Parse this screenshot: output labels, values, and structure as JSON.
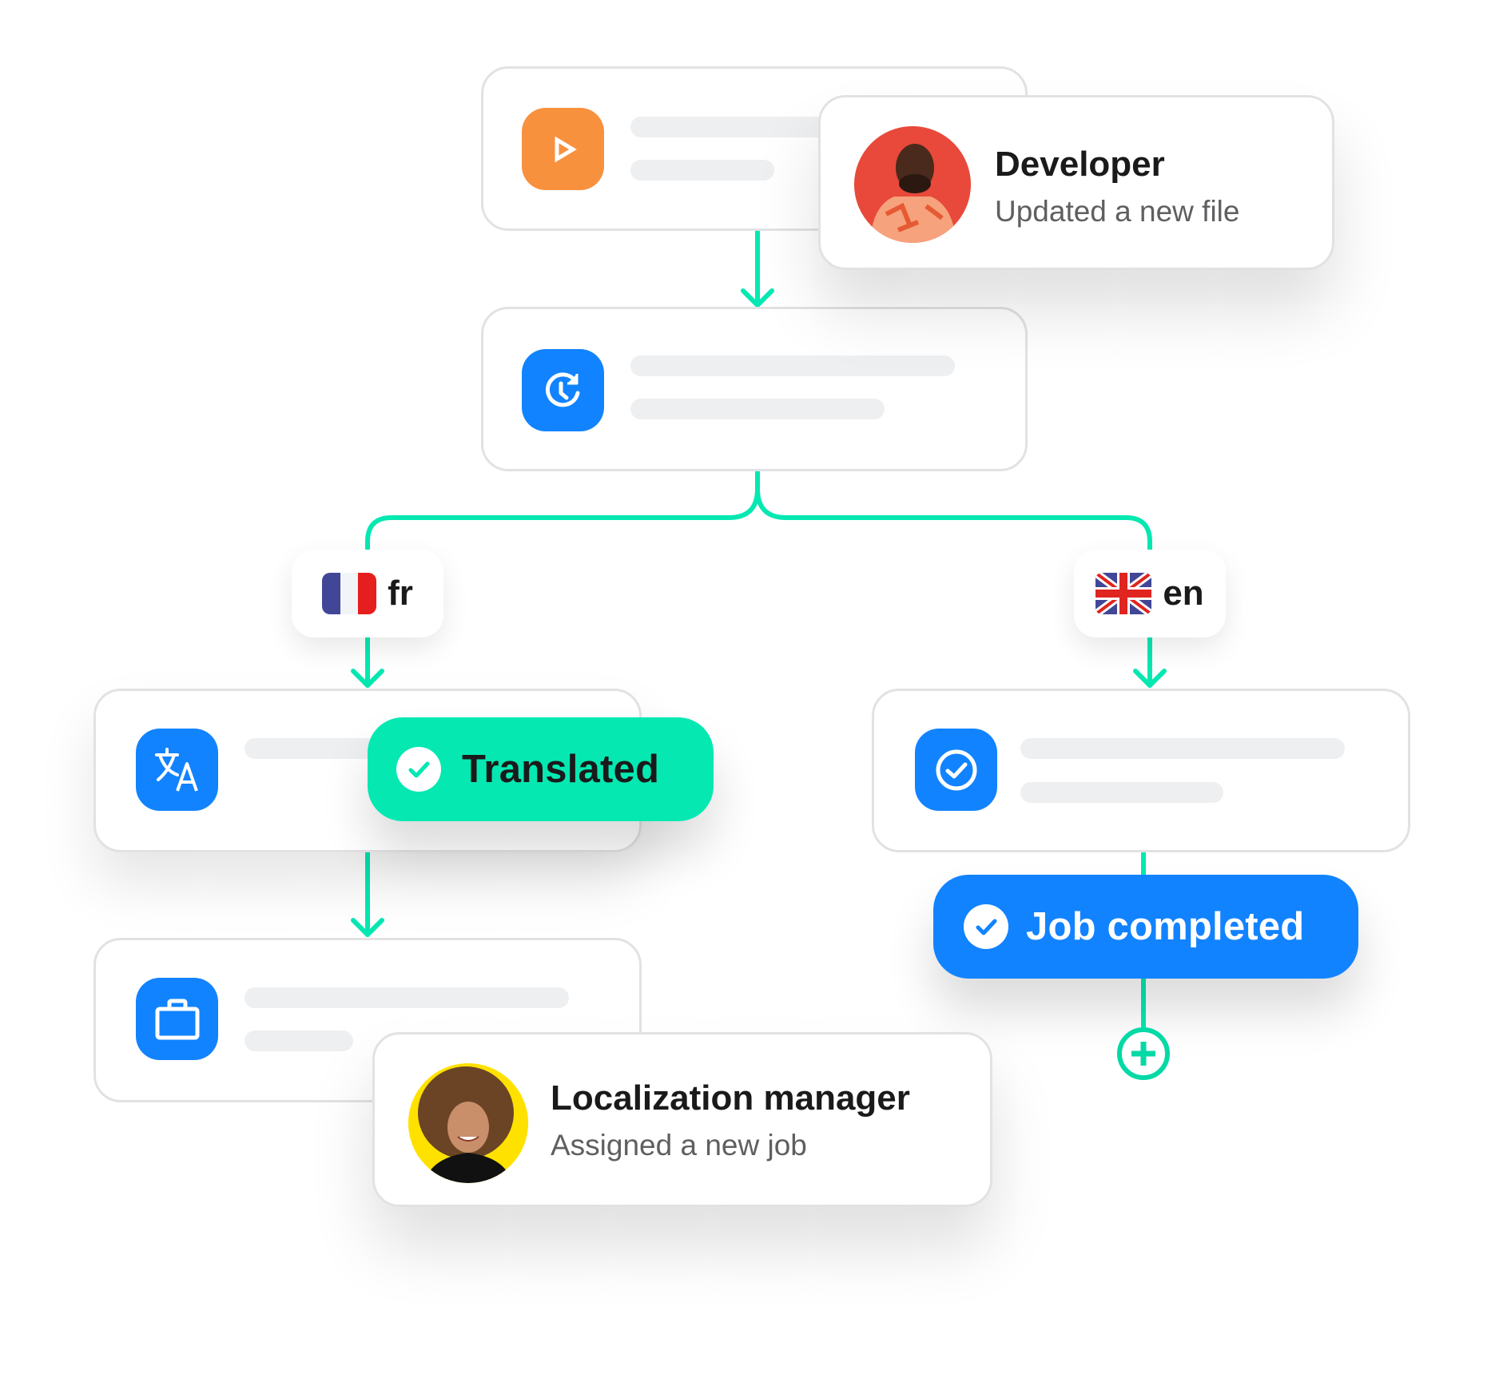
{
  "colors": {
    "accent_green": "#05E8B2",
    "accent_blue": "#1283FF",
    "accent_orange": "#F8913E",
    "placeholder_bar": "#EEEFF1",
    "card_border": "#E2E2E4"
  },
  "workflow": {
    "start_node": {
      "icon": "play-icon",
      "placeholder_lines": 2
    },
    "schedule_node": {
      "icon": "clock-refresh-icon",
      "placeholder_lines": 2
    },
    "branches": [
      {
        "language_code": "fr",
        "flag": "france-flag-icon"
      },
      {
        "language_code": "en",
        "flag": "uk-flag-icon"
      }
    ],
    "translate_node": {
      "icon": "translate-icon",
      "placeholder_lines": 1
    },
    "review_node": {
      "icon": "check-circle-icon",
      "placeholder_lines": 2
    },
    "job_node": {
      "icon": "briefcase-icon",
      "placeholder_lines": 2
    },
    "add_step": {
      "icon": "plus-circle-icon"
    }
  },
  "status_pills": {
    "translated": {
      "label": "Translated",
      "icon": "check-circle-icon"
    },
    "job_completed": {
      "label": "Job completed",
      "icon": "check-circle-icon"
    }
  },
  "notifications": {
    "developer": {
      "title": "Developer",
      "subtitle": "Updated a new file",
      "avatar_bg": "#E8493A"
    },
    "localization_manager": {
      "title": "Localization manager",
      "subtitle": "Assigned a new job",
      "avatar_bg": "#FFE100"
    }
  }
}
